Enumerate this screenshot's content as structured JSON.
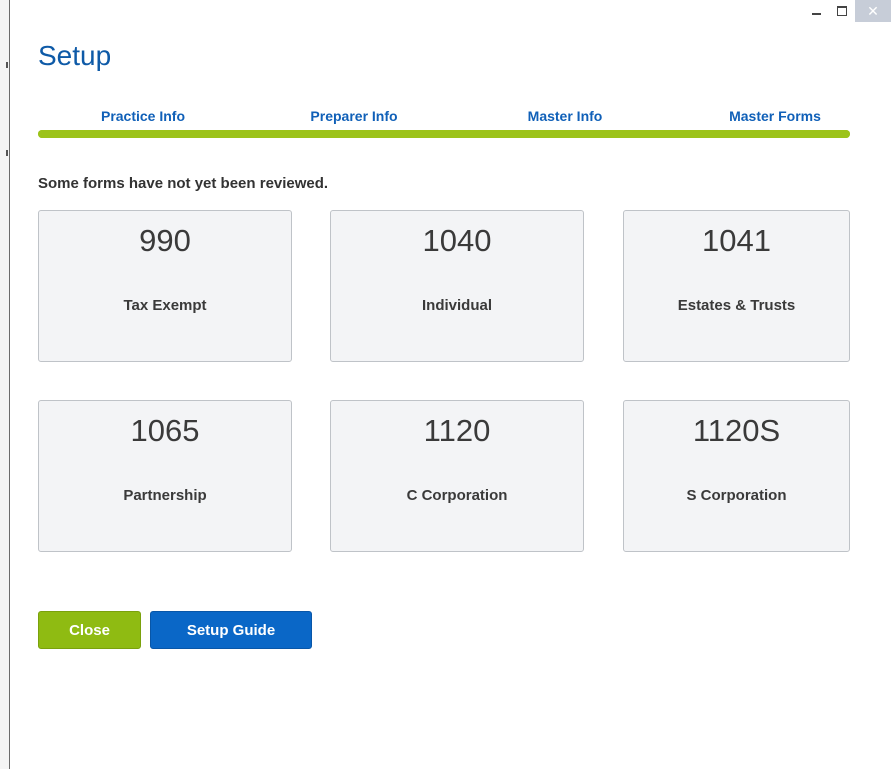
{
  "window": {
    "controls": [
      {
        "name": "minimize",
        "icon": "minimize-icon"
      },
      {
        "name": "maximize",
        "icon": "maximize-icon"
      },
      {
        "name": "close",
        "icon": "close-icon",
        "glyph": "✕"
      }
    ]
  },
  "header": {
    "title": "Setup"
  },
  "steps": {
    "tabs": [
      {
        "label": "Practice Info"
      },
      {
        "label": "Preparer Info"
      },
      {
        "label": "Master Info"
      },
      {
        "label": "Master Forms"
      }
    ],
    "progress": 1.0,
    "progress_color": "#9cc31a"
  },
  "status": {
    "message": "Some forms have not yet been reviewed."
  },
  "forms": [
    {
      "number": "990",
      "name": "Tax Exempt"
    },
    {
      "number": "1040",
      "name": "Individual"
    },
    {
      "number": "1041",
      "name": "Estates & Trusts"
    },
    {
      "number": "1065",
      "name": "Partnership"
    },
    {
      "number": "1120",
      "name": "C Corporation"
    },
    {
      "number": "1120S",
      "name": "S Corporation"
    }
  ],
  "actions": {
    "close_label": "Close",
    "close_color": "#8fbb12",
    "guide_label": "Setup Guide",
    "guide_color": "#0a67c7"
  },
  "colors": {
    "title": "#0e5aa7",
    "tab_text": "#1060b8",
    "card_bg": "#f3f4f6"
  }
}
